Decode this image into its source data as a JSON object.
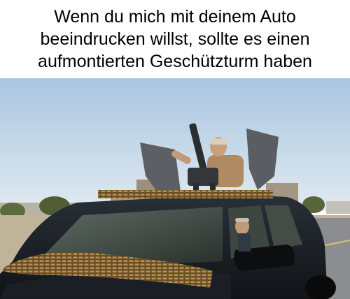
{
  "caption": {
    "line1": "Wenn du mich mit deinem Auto",
    "line2": "beeindrucken willst, sollte es einen",
    "line3": "aufmontierten Geschützturm haben"
  },
  "colors": {
    "sky_top": "#a9c6e0",
    "sky_bottom": "#dfe9f1",
    "car_body": "#1b1f24",
    "road": "#8b8d90",
    "ground": "#bfb39a",
    "bullets": "#8a6a3a"
  }
}
